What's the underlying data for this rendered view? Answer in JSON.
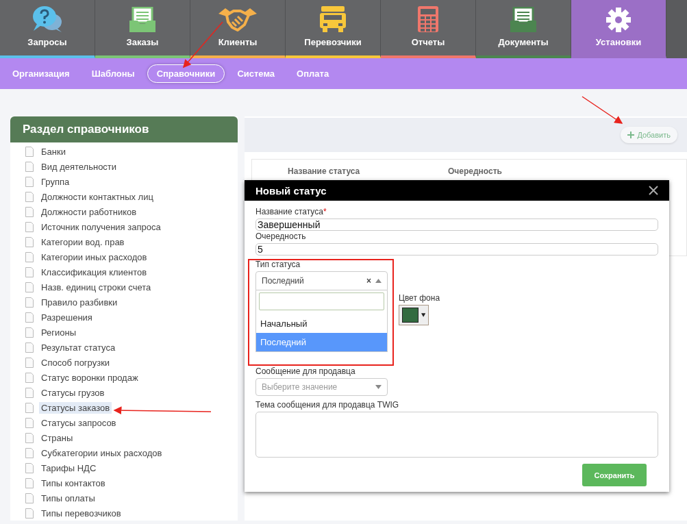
{
  "nav": {
    "tabs": [
      {
        "label": "Запросы",
        "kind": "question",
        "color": "#5bc0eb",
        "selected": false
      },
      {
        "label": "Заказы",
        "kind": "inbox",
        "color": "#7cc576",
        "selected": false
      },
      {
        "label": "Клиенты",
        "kind": "handshake",
        "color": "#f5b04a",
        "selected": false
      },
      {
        "label": "Перевозчики",
        "kind": "truck",
        "color": "#f8c73b",
        "selected": false
      },
      {
        "label": "Отчеты",
        "kind": "calculator",
        "color": "#f0776c",
        "selected": false
      },
      {
        "label": "Документы",
        "kind": "inbox",
        "color": "#4c8550",
        "selected": false
      },
      {
        "label": "Установки",
        "kind": "gear",
        "color": "#9b6fc6",
        "selected": true
      }
    ]
  },
  "subnav": {
    "items": [
      {
        "label": "Организация",
        "selected": false
      },
      {
        "label": "Шаблоны",
        "selected": false
      },
      {
        "label": "Справочники",
        "selected": true
      },
      {
        "label": "Система",
        "selected": false
      },
      {
        "label": "Оплата",
        "selected": false
      }
    ]
  },
  "sidebar": {
    "title": "Раздел справочников",
    "items": [
      {
        "label": "Банки",
        "selected": false
      },
      {
        "label": "Вид деятельности",
        "selected": false
      },
      {
        "label": "Группа",
        "selected": false
      },
      {
        "label": "Должности контактных лиц",
        "selected": false
      },
      {
        "label": "Должности работников",
        "selected": false
      },
      {
        "label": "Источник получения запроса",
        "selected": false
      },
      {
        "label": "Категории вод. прав",
        "selected": false
      },
      {
        "label": "Категории иных расходов",
        "selected": false
      },
      {
        "label": "Классификация клиентов",
        "selected": false
      },
      {
        "label": "Назв. единиц строки счета",
        "selected": false
      },
      {
        "label": "Правило разбивки",
        "selected": false
      },
      {
        "label": "Разрешения",
        "selected": false
      },
      {
        "label": "Регионы",
        "selected": false
      },
      {
        "label": "Результат статуса",
        "selected": false
      },
      {
        "label": "Способ погрузки",
        "selected": false
      },
      {
        "label": "Статус воронки продаж",
        "selected": false
      },
      {
        "label": "Статусы грузов",
        "selected": false
      },
      {
        "label": "Статусы заказов",
        "selected": true
      },
      {
        "label": "Статусы запросов",
        "selected": false
      },
      {
        "label": "Страны",
        "selected": false
      },
      {
        "label": "Субкатегории иных расходов",
        "selected": false
      },
      {
        "label": "Тарифы НДС",
        "selected": false
      },
      {
        "label": "Типы контактов",
        "selected": false
      },
      {
        "label": "Типы оплаты",
        "selected": false
      },
      {
        "label": "Типы перевозчиков",
        "selected": false
      }
    ]
  },
  "toolbar": {
    "add_button": "Добавить"
  },
  "table": {
    "columns": [
      "Название статуса",
      "Очередность"
    ]
  },
  "modal": {
    "title": "Новый статус",
    "name_field": {
      "label": "Название статуса",
      "required_mark": "*",
      "value": "Завершенный"
    },
    "order_field": {
      "label": "Очередность",
      "value": "5"
    },
    "type_field": {
      "label": "Тип статуса",
      "value": "Последний",
      "clear": "×",
      "expanded": true,
      "options": [
        {
          "label": "Начальный",
          "selected": false
        },
        {
          "label": "Последний",
          "selected": true
        }
      ]
    },
    "color_field": {
      "label": "Цвет фона"
    },
    "seller_message_field": {
      "label": "Сообщение для продавца",
      "placeholder": "Выберите значение"
    },
    "subject_field": {
      "label": "Тема сообщения для продавца TWIG"
    },
    "save_button": "Сохранить"
  }
}
